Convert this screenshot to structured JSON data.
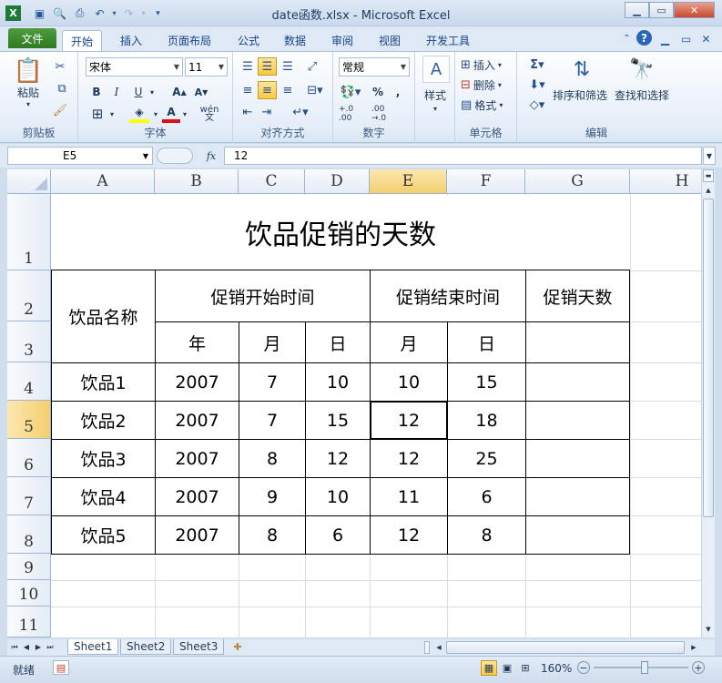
{
  "window": {
    "title": "date函数.xlsx  -  Microsoft Excel"
  },
  "qat": {
    "undo_icon": "undo-icon",
    "redo_icon": "redo-icon"
  },
  "tabs": {
    "file": "文件",
    "items": [
      "开始",
      "插入",
      "页面布局",
      "公式",
      "数据",
      "审阅",
      "视图",
      "开发工具"
    ]
  },
  "ribbon": {
    "clipboard": {
      "label": "剪贴板",
      "paste": "粘贴"
    },
    "font": {
      "label": "字体",
      "name": "宋体",
      "size": "11",
      "wen": "wén"
    },
    "align": {
      "label": "对齐方式"
    },
    "number": {
      "label": "数字",
      "format": "常规",
      "percent": "%",
      "comma": ",",
      "inc": "+.0 .00",
      "dec": ".00 →.0"
    },
    "style": {
      "label": "样式"
    },
    "cells": {
      "label": "单元格",
      "insert": "插入",
      "delete": "删除",
      "format": "格式"
    },
    "editing": {
      "label": "编辑",
      "sort": "排序和筛选",
      "find": "查找和选择"
    }
  },
  "formula_bar": {
    "name_box": "E5",
    "fx": "fx",
    "value": "12"
  },
  "columns": [
    "A",
    "B",
    "C",
    "D",
    "E",
    "F",
    "G",
    "H"
  ],
  "rows": [
    "1",
    "2",
    "3",
    "4",
    "5",
    "6",
    "7",
    "8",
    "9",
    "10",
    "11"
  ],
  "sheet": {
    "title": "饮品促销的天数",
    "h_name": "饮品名称",
    "h_start": "促销开始时间",
    "h_end": "促销结束时间",
    "h_days": "促销天数",
    "sub_year": "年",
    "sub_month": "月",
    "sub_day": "日",
    "sub_month2": "月",
    "sub_day2": "日",
    "data": [
      [
        "饮品1",
        "2007",
        "7",
        "10",
        "10",
        "15"
      ],
      [
        "饮品2",
        "2007",
        "7",
        "15",
        "12",
        "18"
      ],
      [
        "饮品3",
        "2007",
        "8",
        "12",
        "12",
        "25"
      ],
      [
        "饮品4",
        "2007",
        "9",
        "10",
        "11",
        "6"
      ],
      [
        "饮品5",
        "2007",
        "8",
        "6",
        "12",
        "8"
      ]
    ]
  },
  "sheet_tabs": [
    "Sheet1",
    "Sheet2",
    "Sheet3"
  ],
  "status": {
    "ready": "就绪",
    "zoom": "160%"
  }
}
